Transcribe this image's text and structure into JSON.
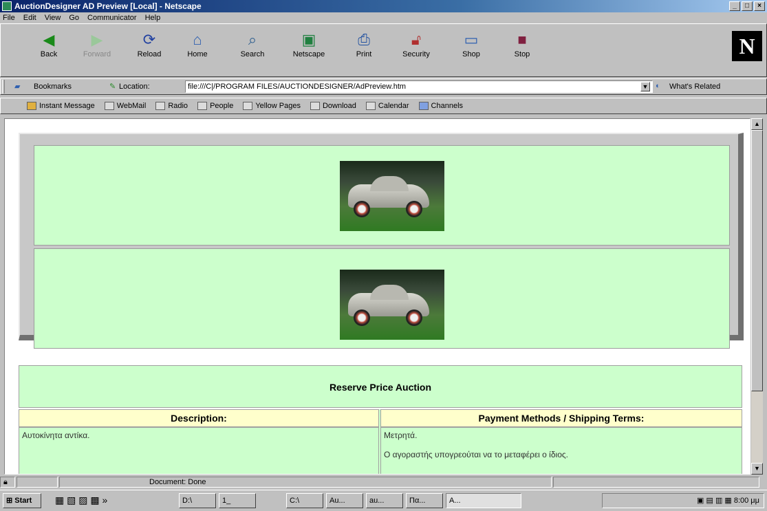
{
  "window": {
    "title": "AuctionDesigner AD Preview [Local] - Netscape"
  },
  "menu": [
    "File",
    "Edit",
    "View",
    "Go",
    "Communicator",
    "Help"
  ],
  "toolbar": {
    "buttons": [
      {
        "label": "Back",
        "icon": "back-arrow-icon"
      },
      {
        "label": "Forward",
        "icon": "forward-arrow-icon"
      },
      {
        "label": "Reload",
        "icon": "reload-icon"
      },
      {
        "label": "Home",
        "icon": "home-icon"
      },
      {
        "label": "Search",
        "icon": "search-icon"
      },
      {
        "label": "Netscape",
        "icon": "netscape-icon"
      },
      {
        "label": "Print",
        "icon": "print-icon"
      },
      {
        "label": "Security",
        "icon": "security-lock-icon"
      },
      {
        "label": "Shop",
        "icon": "shop-icon"
      },
      {
        "label": "Stop",
        "icon": "stop-icon"
      }
    ]
  },
  "location": {
    "bookmarks_label": "Bookmarks",
    "location_label": "Location:",
    "url": "file:///C|/PROGRAM FILES/AUCTIONDESIGNER/AdPreview.htm",
    "whats_related": "What's Related"
  },
  "personal_toolbar": [
    "Instant Message",
    "WebMail",
    "Radio",
    "People",
    "Yellow Pages",
    "Download",
    "Calendar",
    "Channels"
  ],
  "page": {
    "auction_type": "Reserve Price Auction",
    "description_header": "Description:",
    "payment_header": "Payment Methods / Shipping Terms:",
    "description_text": "Αυτοκίνητα αντίκα.",
    "payment_text_1": "Μετρητά.",
    "payment_text_2": "Ο αγοραστής υπογρεούται να το μεταφέρει ο ίδιος."
  },
  "statusbar": {
    "text": "Document: Done"
  },
  "taskbar": {
    "start_label": "Start",
    "items": [
      "D:\\",
      "1_",
      "C:\\",
      "Au...",
      "au...",
      "Πα...",
      "A..."
    ],
    "clock": "8:00 μμ"
  },
  "colors": {
    "cell_green": "#ccffcc",
    "header_yellow": "#ffffcc",
    "title_blue": "#0a246a"
  }
}
